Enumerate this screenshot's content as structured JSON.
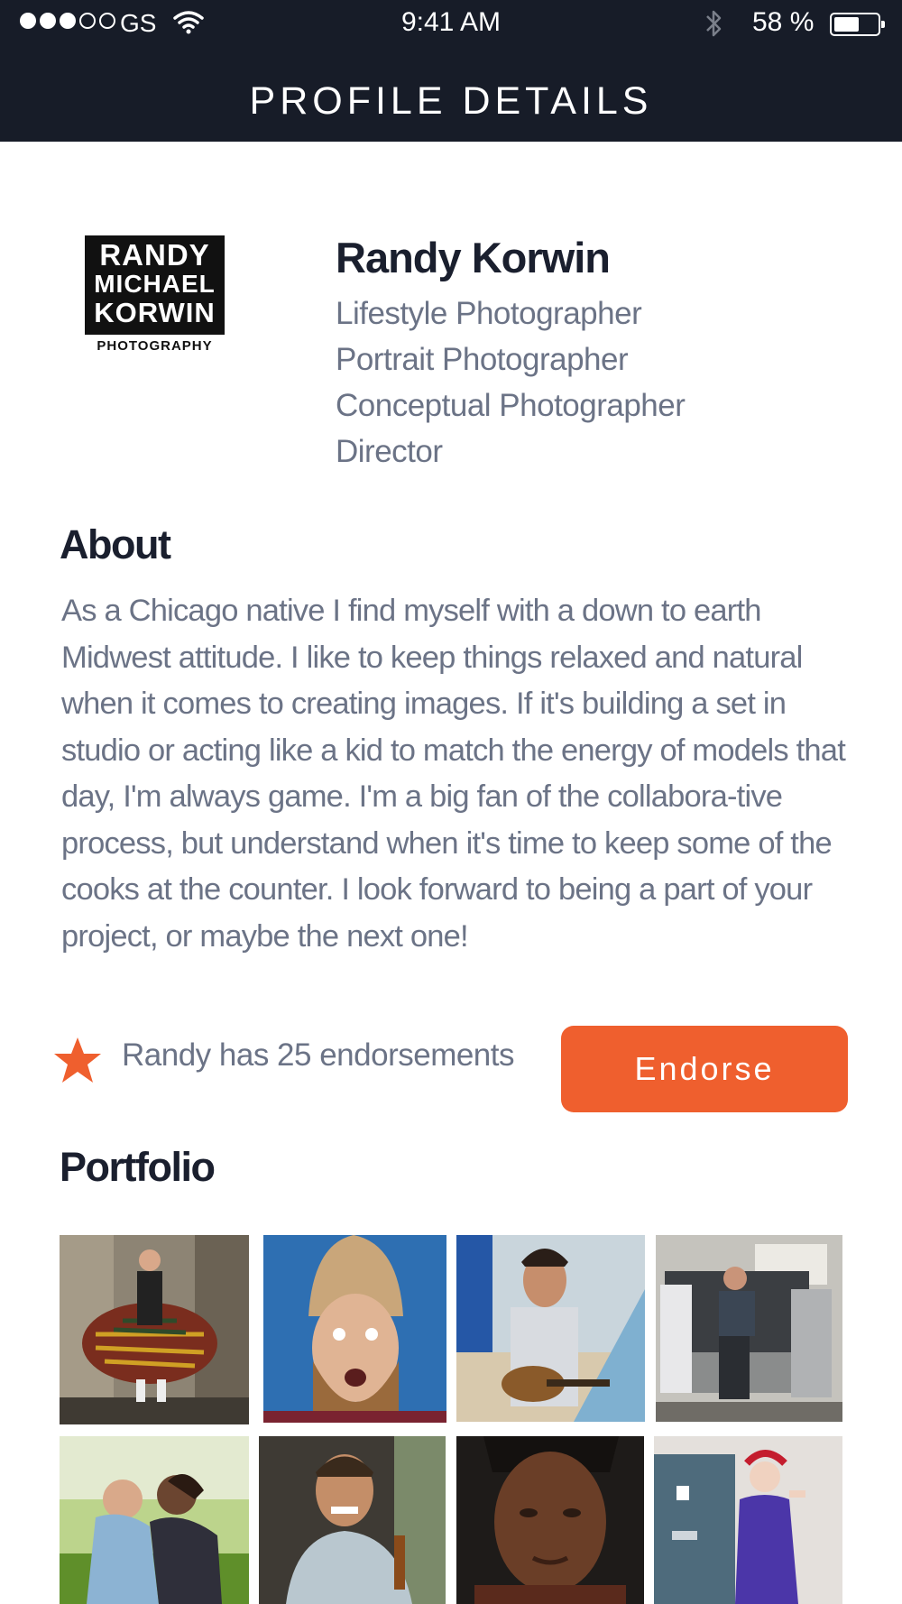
{
  "status_bar": {
    "carrier": "GS",
    "time": "9:41 AM",
    "battery_percent": "58 %",
    "battery_level": 0.58,
    "signal_bars_filled": 3,
    "signal_bars_total": 5
  },
  "header": {
    "title": "PROFILE DETAILS"
  },
  "profile": {
    "logo_text": [
      "RANDY",
      "MICHAEL",
      "KORWIN",
      "PHOTOGRAPHY"
    ],
    "name": "Randy Korwin",
    "roles": [
      "Lifestyle Photographer",
      "Portrait Photographer",
      "Conceptual Photographer",
      "Director"
    ]
  },
  "about": {
    "heading": "About",
    "text": "As a Chicago native I find myself with a down to earth Midwest attitude. I like to keep things relaxed and natural when it comes to creating images. If it's building a set in studio or acting like a kid to match the energy of models that day, I'm always game. I'm a big fan of the collabora-tive process, but understand when it's time to keep some of the cooks at the counter. I look forward to being a part of your project, or maybe the next one!"
  },
  "endorsements": {
    "text": "Randy has 25 endorsements",
    "button_label": "Endorse"
  },
  "portfolio": {
    "heading": "Portfolio"
  },
  "colors": {
    "header_bg": "#171c28",
    "accent": "#ef5f2e",
    "heading_text": "#1a1f2e",
    "body_text": "#6b7386"
  }
}
